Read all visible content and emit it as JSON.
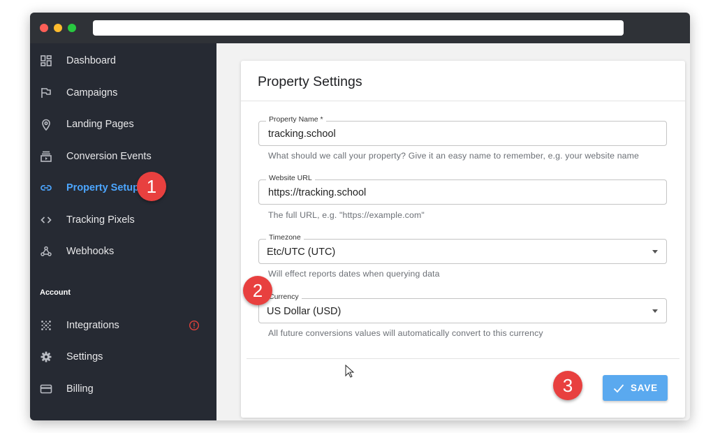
{
  "window": {
    "url": ""
  },
  "sidebar": {
    "items": [
      {
        "label": "Dashboard",
        "icon": "dashboard-icon"
      },
      {
        "label": "Campaigns",
        "icon": "flag-icon"
      },
      {
        "label": "Landing Pages",
        "icon": "location-pin-icon"
      },
      {
        "label": "Conversion Events",
        "icon": "video-library-icon"
      },
      {
        "label": "Property Setup",
        "icon": "link-icon",
        "active": true
      },
      {
        "label": "Tracking Pixels",
        "icon": "code-icon"
      },
      {
        "label": "Webhooks",
        "icon": "webhook-icon"
      }
    ],
    "account_heading": "Account",
    "account_items": [
      {
        "label": "Integrations",
        "icon": "grid-dots-icon",
        "alert": true
      },
      {
        "label": "Settings",
        "icon": "gear-icon"
      },
      {
        "label": "Billing",
        "icon": "credit-card-icon"
      }
    ]
  },
  "form": {
    "title": "Property Settings",
    "property_name": {
      "label": "Property Name *",
      "value": "tracking.school",
      "helper": "What should we call your property? Give it an easy name to remember, e.g. your website name"
    },
    "website_url": {
      "label": "Website URL",
      "value": "https://tracking.school",
      "helper": "The full URL, e.g. \"https://example.com\""
    },
    "timezone": {
      "label": "Timezone",
      "value": "Etc/UTC (UTC)",
      "helper": "Will effect reports dates when querying data"
    },
    "currency": {
      "label": "Currency",
      "value": "US Dollar (USD)",
      "helper": "All future conversions values will automatically convert to this currency"
    },
    "save_label": "SAVE"
  },
  "annotations": {
    "step1": "1",
    "step2": "2",
    "step3": "3"
  },
  "colors": {
    "sidebar_bg": "#262a33",
    "active_accent": "#4ca6ff",
    "save_button": "#5aa9ef",
    "badge": "#e8403f",
    "alert": "#e0413b"
  }
}
